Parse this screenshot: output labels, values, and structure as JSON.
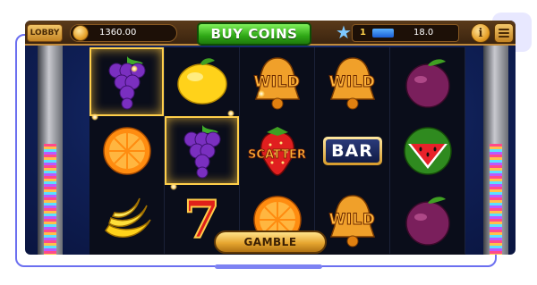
{
  "topbar": {
    "lobby_label": "LOBBY",
    "coins_value": "1360.00",
    "buy_coins_label": "BUY COINS",
    "level_value": "1",
    "bet_value": "18.0",
    "info_label": "i"
  },
  "reels": [
    [
      "grapes",
      "orange",
      "banana"
    ],
    [
      "lemon",
      "grapes",
      "seven"
    ],
    [
      "wild",
      "scatter",
      "orange"
    ],
    [
      "wild",
      "bar",
      "wild"
    ],
    [
      "plum",
      "watermelon",
      "plum"
    ]
  ],
  "symbols": {
    "wild_text": "WILD",
    "scatter_text": "SCATTER",
    "bar_text": "BAR",
    "seven_text": "7"
  },
  "gamble_label": "GAMBLE",
  "colors": {
    "background": "#0f1f55",
    "topbar": "#3b240f",
    "buy_button": "#2fa816",
    "gold_accent": "#e6a630",
    "win_highlight": "#ffcf4a"
  }
}
